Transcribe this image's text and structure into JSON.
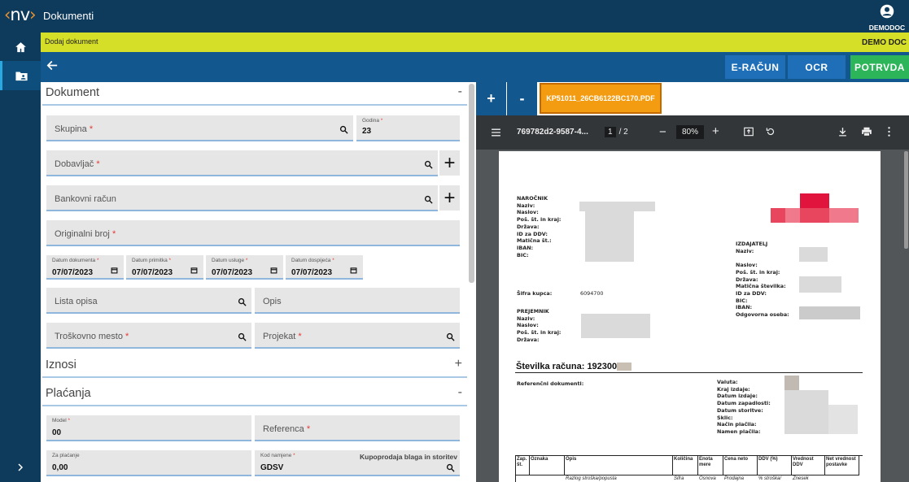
{
  "app": {
    "logo": "nv",
    "title": "Dokumenti",
    "user": "DEMODOC"
  },
  "breadcrumb": {
    "page": "Dodaj dokument",
    "company": "DEMO DOC"
  },
  "toolbar": {
    "erac": "E-RAČUN",
    "ocr": "OCR",
    "potrvda": "POTRVDA"
  },
  "colors": {
    "topbar": "#0e3a5b",
    "yellow": "#d6df27",
    "blue": "#13578f",
    "erac": "#1e6fb8",
    "ocr": "#1e6fb8",
    "potrvda": "#2db559",
    "filetab": "#f39c12"
  },
  "form": {
    "sec_dokument": "Dokument",
    "sec_dokument_toggle": "-",
    "skupina": "Skupina",
    "godina_label": "Godina",
    "godina_value": "23",
    "dobavljac": "Dobavljač",
    "bankovni": "Bankovni račun",
    "originalni": "Originalni broj",
    "datum_dokumenta_label": "Datum dokumenta",
    "datum_dokumenta": "07/07/2023",
    "datum_primitka_label": "Datum primitka",
    "datum_primitka": "07/07/2023",
    "datum_usluge_label": "Datum usluge",
    "datum_usluge": "07/07/2023",
    "datum_dospijeca_label": "Datum dospijeća",
    "datum_dospijeca": "07/07/2023",
    "lista_opisa": "Lista opisa",
    "opis": "Opis",
    "troskovno": "Troškovno mesto",
    "projekat": "Projekat",
    "sec_iznosi": "Iznosi",
    "sec_iznosi_toggle": "+",
    "sec_placanja": "Plaćanja",
    "sec_placanja_toggle": "-",
    "model_label": "Model",
    "model_value": "00",
    "referenca": "Referenca",
    "za_placanje_label": "Za plaćanje",
    "za_placanje_value": "0,00",
    "kod_namjene_label": "Kod namjene",
    "kod_namjene_value": "GDSV",
    "kod_namjene_desc": "Kupoprodaja blaga in storitev",
    "req_mark": "*"
  },
  "pdf": {
    "plus": "+",
    "minus": "-",
    "file_tab": "KP51011_26CB6122BC170.PDF",
    "filename": "769782d2-9587-4...",
    "page_current": "1",
    "page_sep": "/",
    "page_total": "2",
    "zoom": "80%",
    "narocnik_labels": [
      "NAROČNIK",
      "Naziv:",
      "Naslov:",
      "Poš. št. in kraj:",
      "Država:",
      "ID za DDV:",
      "Matična št.:",
      "IBAN:",
      "BIC:"
    ],
    "izdajatelj_labels": [
      "IZDAJATELJ",
      "Naziv:",
      "",
      "Naslov:",
      "Poš. št. in kraj:",
      "Država:",
      "Matična številka:",
      "ID za DDV:",
      "BIC:",
      "IBAN:",
      "Odgovorna oseba:"
    ],
    "sifra_kupca_label": "Šifra kupca:",
    "sifra_kupca": "6094700",
    "prejemnik_labels": [
      "PREJEMNIK",
      "Naziv:",
      "Naslov:",
      "Poš. št. in kraj:",
      "Država:"
    ],
    "stevilka_label": "Številka računa:",
    "stevilka_value": "192300",
    "ref_doc": "Referenčni dokumenti:",
    "meta_labels": [
      "Valuta:",
      "Kraj izdaje:",
      "Datum izdaje:",
      "Datum zapadlosti:",
      "Datum storitve:",
      "Sklic:",
      "Način plačila:",
      "Namen plačila:"
    ],
    "table_headers": [
      "Zap. št.",
      "Oznaka",
      "Opis",
      "Količina",
      "Enota mere",
      "Cena neto",
      "DDV (%)",
      "Vrednost DDV",
      "Net vrednost postavke"
    ],
    "table_row": [
      "",
      "",
      "Razlog stroška/popusta",
      "Šifra",
      "Osnova",
      "Prodajna",
      "% stroška/",
      "Znesek",
      ""
    ]
  }
}
